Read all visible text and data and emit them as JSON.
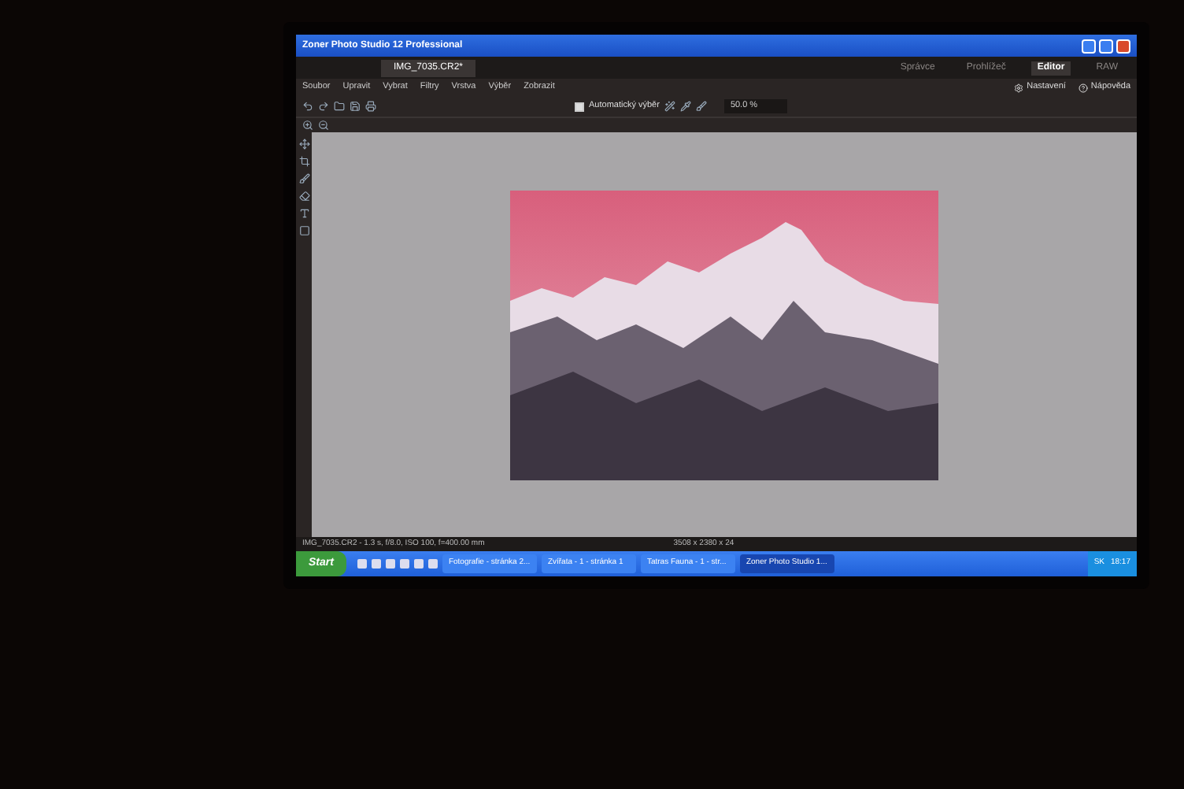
{
  "window": {
    "title": "Zoner Photo Studio 12 Professional"
  },
  "document_tabs": [
    {
      "label": "IMG_7035.CR2*",
      "selected": true
    }
  ],
  "modes": [
    {
      "label": "Správce",
      "selected": false
    },
    {
      "label": "Prohlížeč",
      "selected": false
    },
    {
      "label": "Editor",
      "selected": true
    },
    {
      "label": "RAW",
      "selected": false
    }
  ],
  "header_links": [
    "Nastavení",
    "Nápověda"
  ],
  "menu": [
    "Soubor",
    "Upravit",
    "Vybrat",
    "Filtry",
    "Vrstva",
    "Výběr",
    "Zobrazit"
  ],
  "toolbar": {
    "auto_select": "Automatický výběr",
    "auto_select_checked": true,
    "zoom": "50.0 %"
  },
  "status_bar": {
    "file_info": "IMG_7035.CR2 - 1.3 s, f/8.0, ISO 100, f=400.00 mm",
    "dimensions": "3508 x 2380 x 24"
  },
  "taskbar": {
    "start": "Start",
    "tasks": [
      {
        "label": "Fotografie - stránka 2...",
        "selected": false
      },
      {
        "label": "Zvířata - 1 - stránka 1",
        "selected": false
      },
      {
        "label": "Tatras Fauna - 1 - str...",
        "selected": false
      },
      {
        "label": "Zoner Photo Studio 1...",
        "selected": true
      }
    ],
    "language": "SK",
    "clock": "18:17"
  }
}
